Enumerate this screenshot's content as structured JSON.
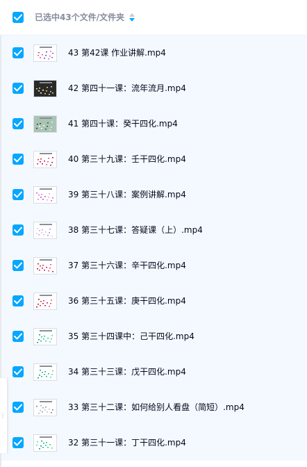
{
  "header": {
    "title": "已选中43个文件/文件夹"
  },
  "colors": {
    "accent": "#06a7ff",
    "row_background": "#f4f9ff",
    "header_text": "#878c9c",
    "file_text": "#03081a"
  },
  "files": [
    {
      "name": "43 第42课 作业讲解.mp4",
      "thumb": "purple",
      "checked": true
    },
    {
      "name": "42 第四十一课：流年流月.mp4",
      "thumb": "dark",
      "checked": true
    },
    {
      "name": "41 第四十课：癸干四化.mp4",
      "thumb": "green",
      "checked": true
    },
    {
      "name": "40 第三十九课：壬干四化.mp4",
      "thumb": "red",
      "checked": true
    },
    {
      "name": "39 第三十八课：案例讲解.mp4",
      "thumb": "pink",
      "checked": true
    },
    {
      "name": "38 第三十七课：答疑课（上）.mp4",
      "thumb": "lilac",
      "checked": true
    },
    {
      "name": "37 第三十六课：辛干四化.mp4",
      "thumb": "red",
      "checked": true
    },
    {
      "name": "36 第三十五课：庚干四化.mp4",
      "thumb": "red",
      "checked": true
    },
    {
      "name": "35 第三十四课中：己干四化.mp4",
      "thumb": "teal",
      "checked": true
    },
    {
      "name": "34 第三十三课：戊干四化.mp4",
      "thumb": "teal",
      "checked": true
    },
    {
      "name": "33 第三十二课：如何给别人看盘（简短）.mp4",
      "thumb": "gray",
      "checked": true
    },
    {
      "name": "32 第三十一课：丁干四化.mp4",
      "thumb": "teal",
      "checked": true
    }
  ]
}
